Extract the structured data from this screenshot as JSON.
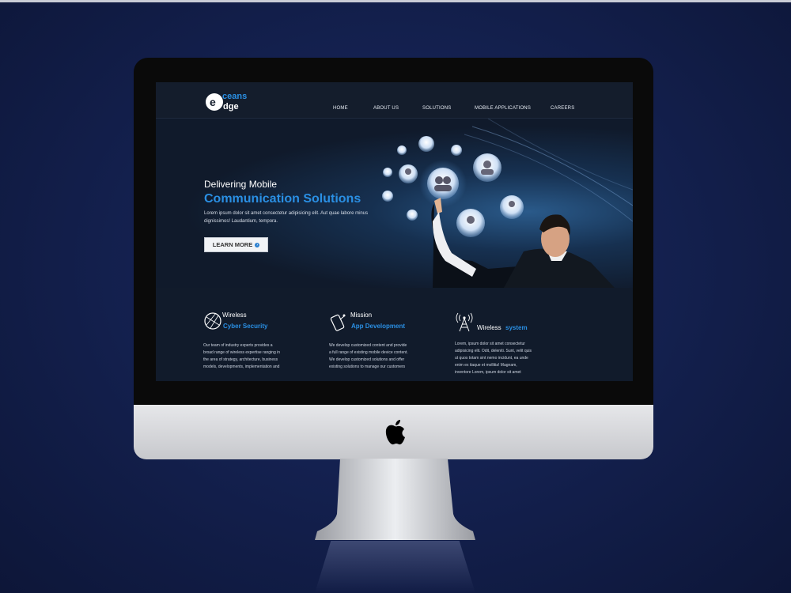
{
  "site": {
    "logo_text": "eceans edge",
    "nav": [
      "HOME",
      "ABOUT US",
      "SOLUTIONS",
      "MOBILE APPLICATIONS",
      "CAREERS"
    ]
  },
  "hero": {
    "title_line1": "Delivering Mobile",
    "title_line2": "Communication Solutions",
    "description": "Lorem ipsum dolor sit amet consectetur adipisicing elit. Aut quae labore minus dignissimos! Laudantium, tempora.",
    "cta_label": "LEARN MORE"
  },
  "features": [
    {
      "title_a": "Wireless",
      "title_b": "Cyber Security",
      "icon": "globe-icon",
      "description": "Our team of industry experts provides a broad range of wireless expertise ranging in the area of strategy, architecture, business models, developments, implementation and"
    },
    {
      "title_a": "Mission",
      "title_b": "App Development",
      "icon": "mobile-app-icon",
      "description": "We develop customized content and provide a full range of existing mobile device content. We develop customized solutions and offer existing solutions to manage our customers"
    },
    {
      "title_a": "Wireless",
      "title_b": "system",
      "icon": "antenna-tower-icon",
      "description": "Lorem, ipsum dolor sit amet consectetur adipisicing elit. Odit, deleniti. Sunt, velit quis ut quos totam sint nemo incidunt, ea unde enim ex itaque et mollitia! Magnam, inventore Lorem, ipsum dolor sit amet"
    }
  ],
  "colors": {
    "accent": "#2a8fe3",
    "page_bg": "#111b2b",
    "backdrop": "#142150"
  }
}
